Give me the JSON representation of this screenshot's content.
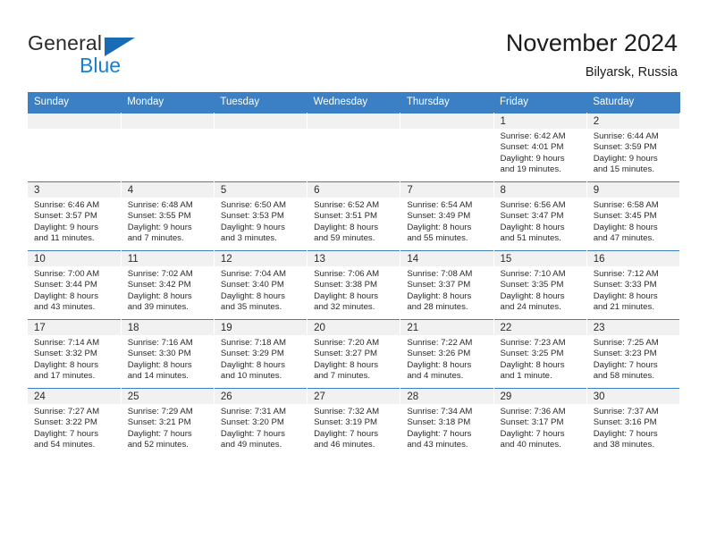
{
  "brand": {
    "name_top": "General",
    "name_bottom": "Blue",
    "triangle_icon": "blue-triangle-logo",
    "color_dark": "#2b2b2b",
    "color_blue": "#1a7fd4",
    "color_triangle": "#1a6bb5"
  },
  "header": {
    "title": "November 2024",
    "subtitle": "Bilyarsk, Russia"
  },
  "theme": {
    "header_blue": "#3b7fc4",
    "daynum_band": "#f1f1f1",
    "text": "#2b2b2b"
  },
  "weekdays": [
    "Sunday",
    "Monday",
    "Tuesday",
    "Wednesday",
    "Thursday",
    "Friday",
    "Saturday"
  ],
  "weeks": [
    [
      {
        "day": "",
        "sunrise": "",
        "sunset": "",
        "daylight_line1": "",
        "daylight_line2": ""
      },
      {
        "day": "",
        "sunrise": "",
        "sunset": "",
        "daylight_line1": "",
        "daylight_line2": ""
      },
      {
        "day": "",
        "sunrise": "",
        "sunset": "",
        "daylight_line1": "",
        "daylight_line2": ""
      },
      {
        "day": "",
        "sunrise": "",
        "sunset": "",
        "daylight_line1": "",
        "daylight_line2": ""
      },
      {
        "day": "",
        "sunrise": "",
        "sunset": "",
        "daylight_line1": "",
        "daylight_line2": ""
      },
      {
        "day": "1",
        "sunrise": "Sunrise: 6:42 AM",
        "sunset": "Sunset: 4:01 PM",
        "daylight_line1": "Daylight: 9 hours",
        "daylight_line2": "and 19 minutes."
      },
      {
        "day": "2",
        "sunrise": "Sunrise: 6:44 AM",
        "sunset": "Sunset: 3:59 PM",
        "daylight_line1": "Daylight: 9 hours",
        "daylight_line2": "and 15 minutes."
      }
    ],
    [
      {
        "day": "3",
        "sunrise": "Sunrise: 6:46 AM",
        "sunset": "Sunset: 3:57 PM",
        "daylight_line1": "Daylight: 9 hours",
        "daylight_line2": "and 11 minutes."
      },
      {
        "day": "4",
        "sunrise": "Sunrise: 6:48 AM",
        "sunset": "Sunset: 3:55 PM",
        "daylight_line1": "Daylight: 9 hours",
        "daylight_line2": "and 7 minutes."
      },
      {
        "day": "5",
        "sunrise": "Sunrise: 6:50 AM",
        "sunset": "Sunset: 3:53 PM",
        "daylight_line1": "Daylight: 9 hours",
        "daylight_line2": "and 3 minutes."
      },
      {
        "day": "6",
        "sunrise": "Sunrise: 6:52 AM",
        "sunset": "Sunset: 3:51 PM",
        "daylight_line1": "Daylight: 8 hours",
        "daylight_line2": "and 59 minutes."
      },
      {
        "day": "7",
        "sunrise": "Sunrise: 6:54 AM",
        "sunset": "Sunset: 3:49 PM",
        "daylight_line1": "Daylight: 8 hours",
        "daylight_line2": "and 55 minutes."
      },
      {
        "day": "8",
        "sunrise": "Sunrise: 6:56 AM",
        "sunset": "Sunset: 3:47 PM",
        "daylight_line1": "Daylight: 8 hours",
        "daylight_line2": "and 51 minutes."
      },
      {
        "day": "9",
        "sunrise": "Sunrise: 6:58 AM",
        "sunset": "Sunset: 3:45 PM",
        "daylight_line1": "Daylight: 8 hours",
        "daylight_line2": "and 47 minutes."
      }
    ],
    [
      {
        "day": "10",
        "sunrise": "Sunrise: 7:00 AM",
        "sunset": "Sunset: 3:44 PM",
        "daylight_line1": "Daylight: 8 hours",
        "daylight_line2": "and 43 minutes."
      },
      {
        "day": "11",
        "sunrise": "Sunrise: 7:02 AM",
        "sunset": "Sunset: 3:42 PM",
        "daylight_line1": "Daylight: 8 hours",
        "daylight_line2": "and 39 minutes."
      },
      {
        "day": "12",
        "sunrise": "Sunrise: 7:04 AM",
        "sunset": "Sunset: 3:40 PM",
        "daylight_line1": "Daylight: 8 hours",
        "daylight_line2": "and 35 minutes."
      },
      {
        "day": "13",
        "sunrise": "Sunrise: 7:06 AM",
        "sunset": "Sunset: 3:38 PM",
        "daylight_line1": "Daylight: 8 hours",
        "daylight_line2": "and 32 minutes."
      },
      {
        "day": "14",
        "sunrise": "Sunrise: 7:08 AM",
        "sunset": "Sunset: 3:37 PM",
        "daylight_line1": "Daylight: 8 hours",
        "daylight_line2": "and 28 minutes."
      },
      {
        "day": "15",
        "sunrise": "Sunrise: 7:10 AM",
        "sunset": "Sunset: 3:35 PM",
        "daylight_line1": "Daylight: 8 hours",
        "daylight_line2": "and 24 minutes."
      },
      {
        "day": "16",
        "sunrise": "Sunrise: 7:12 AM",
        "sunset": "Sunset: 3:33 PM",
        "daylight_line1": "Daylight: 8 hours",
        "daylight_line2": "and 21 minutes."
      }
    ],
    [
      {
        "day": "17",
        "sunrise": "Sunrise: 7:14 AM",
        "sunset": "Sunset: 3:32 PM",
        "daylight_line1": "Daylight: 8 hours",
        "daylight_line2": "and 17 minutes."
      },
      {
        "day": "18",
        "sunrise": "Sunrise: 7:16 AM",
        "sunset": "Sunset: 3:30 PM",
        "daylight_line1": "Daylight: 8 hours",
        "daylight_line2": "and 14 minutes."
      },
      {
        "day": "19",
        "sunrise": "Sunrise: 7:18 AM",
        "sunset": "Sunset: 3:29 PM",
        "daylight_line1": "Daylight: 8 hours",
        "daylight_line2": "and 10 minutes."
      },
      {
        "day": "20",
        "sunrise": "Sunrise: 7:20 AM",
        "sunset": "Sunset: 3:27 PM",
        "daylight_line1": "Daylight: 8 hours",
        "daylight_line2": "and 7 minutes."
      },
      {
        "day": "21",
        "sunrise": "Sunrise: 7:22 AM",
        "sunset": "Sunset: 3:26 PM",
        "daylight_line1": "Daylight: 8 hours",
        "daylight_line2": "and 4 minutes."
      },
      {
        "day": "22",
        "sunrise": "Sunrise: 7:23 AM",
        "sunset": "Sunset: 3:25 PM",
        "daylight_line1": "Daylight: 8 hours",
        "daylight_line2": "and 1 minute."
      },
      {
        "day": "23",
        "sunrise": "Sunrise: 7:25 AM",
        "sunset": "Sunset: 3:23 PM",
        "daylight_line1": "Daylight: 7 hours",
        "daylight_line2": "and 58 minutes."
      }
    ],
    [
      {
        "day": "24",
        "sunrise": "Sunrise: 7:27 AM",
        "sunset": "Sunset: 3:22 PM",
        "daylight_line1": "Daylight: 7 hours",
        "daylight_line2": "and 54 minutes."
      },
      {
        "day": "25",
        "sunrise": "Sunrise: 7:29 AM",
        "sunset": "Sunset: 3:21 PM",
        "daylight_line1": "Daylight: 7 hours",
        "daylight_line2": "and 52 minutes."
      },
      {
        "day": "26",
        "sunrise": "Sunrise: 7:31 AM",
        "sunset": "Sunset: 3:20 PM",
        "daylight_line1": "Daylight: 7 hours",
        "daylight_line2": "and 49 minutes."
      },
      {
        "day": "27",
        "sunrise": "Sunrise: 7:32 AM",
        "sunset": "Sunset: 3:19 PM",
        "daylight_line1": "Daylight: 7 hours",
        "daylight_line2": "and 46 minutes."
      },
      {
        "day": "28",
        "sunrise": "Sunrise: 7:34 AM",
        "sunset": "Sunset: 3:18 PM",
        "daylight_line1": "Daylight: 7 hours",
        "daylight_line2": "and 43 minutes."
      },
      {
        "day": "29",
        "sunrise": "Sunrise: 7:36 AM",
        "sunset": "Sunset: 3:17 PM",
        "daylight_line1": "Daylight: 7 hours",
        "daylight_line2": "and 40 minutes."
      },
      {
        "day": "30",
        "sunrise": "Sunrise: 7:37 AM",
        "sunset": "Sunset: 3:16 PM",
        "daylight_line1": "Daylight: 7 hours",
        "daylight_line2": "and 38 minutes."
      }
    ]
  ]
}
